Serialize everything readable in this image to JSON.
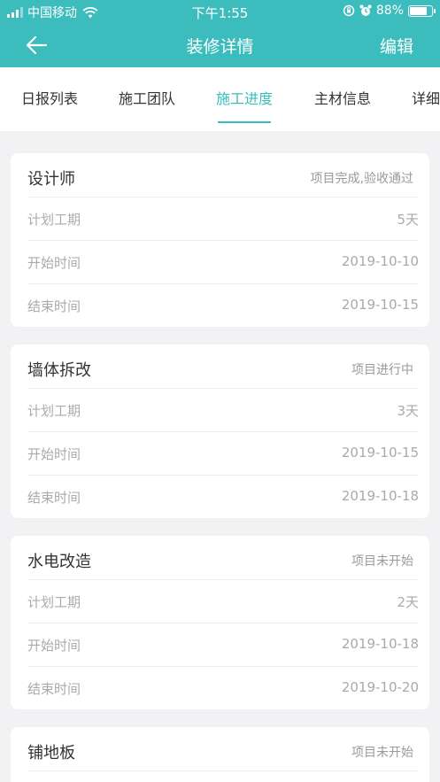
{
  "status_bar": {
    "carrier": "中国移动",
    "time": "下午1:55",
    "battery": "88%",
    "battery_level": 0.88
  },
  "nav": {
    "title": "装修详情",
    "edit_label": "编辑"
  },
  "tabs": [
    {
      "label": "日报列表"
    },
    {
      "label": "施工团队"
    },
    {
      "label": "施工进度",
      "active": true
    },
    {
      "label": "主材信息"
    },
    {
      "label": "详细"
    }
  ],
  "accent_color": "#3cbcbc",
  "stages": [
    {
      "title": "设计师",
      "status": "项目完成,验收通过",
      "rows": [
        {
          "label": "计划工期",
          "value": "5天"
        },
        {
          "label": "开始时间",
          "value": "2019-10-10"
        },
        {
          "label": "结束时间",
          "value": "2019-10-15"
        }
      ]
    },
    {
      "title": "墙体拆改",
      "status": "项目进行中",
      "rows": [
        {
          "label": "计划工期",
          "value": "3天"
        },
        {
          "label": "开始时间",
          "value": "2019-10-15"
        },
        {
          "label": "结束时间",
          "value": "2019-10-18"
        }
      ]
    },
    {
      "title": "水电改造",
      "status": "项目未开始",
      "rows": [
        {
          "label": "计划工期",
          "value": "2天"
        },
        {
          "label": "开始时间",
          "value": "2019-10-18"
        },
        {
          "label": "结束时间",
          "value": "2019-10-20"
        }
      ]
    },
    {
      "title": "铺地板",
      "status": "项目未开始",
      "rows": []
    }
  ]
}
